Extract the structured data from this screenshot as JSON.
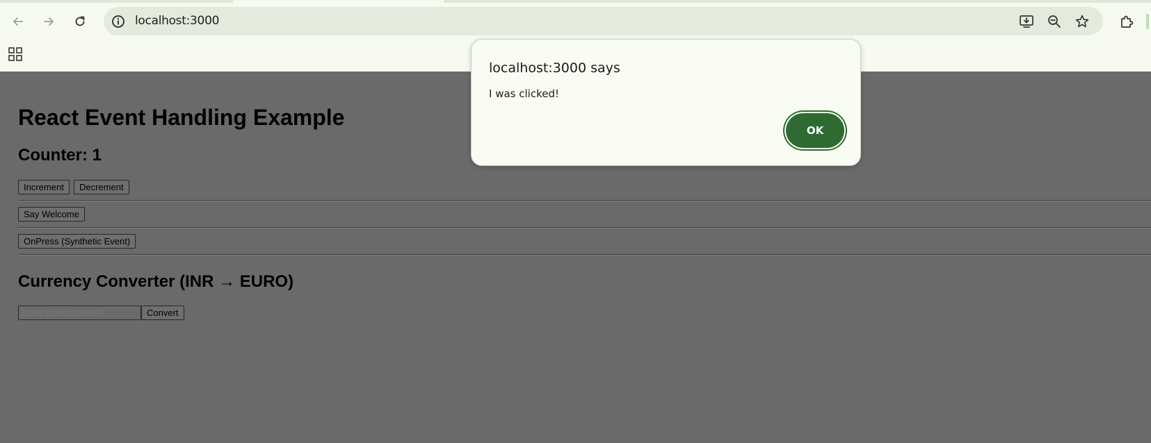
{
  "browser": {
    "url": "localhost:3000",
    "icons": {
      "back": "back-arrow-icon",
      "forward": "forward-arrow-icon",
      "reload": "reload-icon",
      "site_info": "info-icon",
      "install": "install-app-icon",
      "zoom": "zoom-out-icon",
      "bookmark": "star-icon",
      "extensions": "puzzle-icon",
      "apps": "apps-grid-icon"
    }
  },
  "page": {
    "heading": "React Event Handling Example",
    "counter_heading": "Counter: 1",
    "increment_label": "Increment",
    "decrement_label": "Decrement",
    "welcome_label": "Say Welcome",
    "onpress_label": "OnPress (Synthetic Event)",
    "converter_heading": "Currency Converter (INR → EURO)",
    "amount_placeholder": "Enter amount in INR",
    "convert_label": "Convert"
  },
  "dialog": {
    "title": "localhost:3000 says",
    "message": "I was clicked!",
    "ok_label": "OK"
  },
  "colors": {
    "overlay": "#6a6a6a",
    "chrome_bg": "#f6faf0",
    "omnibox_bg": "#e2ebdc",
    "ok_button": "#2f6a33"
  }
}
